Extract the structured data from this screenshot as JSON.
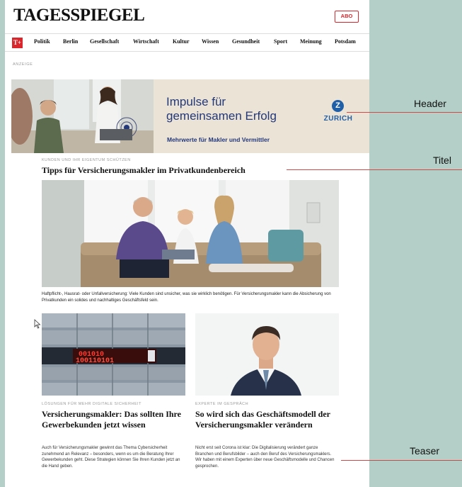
{
  "site": {
    "logo": "TAGESSPIEGEL",
    "abo_button": "ABO",
    "t_logo": "T+"
  },
  "nav": {
    "items": [
      "Politik",
      "Berlin",
      "Gesellschaft",
      "Wirtschaft",
      "Kultur",
      "Wissen",
      "Gesundheit",
      "Sport",
      "Meinung",
      "Potsdam"
    ]
  },
  "ad": {
    "label": "ANZEIGE",
    "headline_line1": "Impulse für",
    "headline_line2": "gemeinsamen Erfolg",
    "tagline": "Mehrwerte für Makler und Vermittler",
    "brand_mark": "Z",
    "brand": "ZURICH"
  },
  "main_article": {
    "kicker": "KUNDEN UND IHR EIGENTUM SCHÜTZEN",
    "title": "Tipps für Versicherungsmakler im Privatkundenbereich",
    "description": "Haftpflicht-, Hausrat- oder Unfallversicherung: Viele Kunden sind unsicher, was sie wirklich benötigen. Für Versicherungsmakler kann die Absicherung von Privatkunden ein solides und nachhaltiges Geschäftsfeld sein."
  },
  "teasers": [
    {
      "kicker": "LÖSUNGEN FÜR MEHR DIGITALE SICHERHEIT",
      "title": "Versicherungsmakler: Das sollten Ihre Gewerbekunden jetzt wissen",
      "text": "Auch für Versicherungsmakler gewinnt das Thema Cybersicherheit zunehmend an Relevanz – besonders, wenn es um die Beratung Ihrer Gewerbekunden geht. Diese Strategien können Sie Ihren Kunden jetzt an die Hand geben.",
      "image_code_line1": "001010",
      "image_code_line2": "100110101"
    },
    {
      "kicker": "EXPERTE IM GESPRÄCH",
      "title": "So wird sich das Geschäftsmodell der Versicherungsmakler verändern",
      "text": "Nicht erst seit Corona ist klar: Die Digitalisierung verändert ganze Branchen und Berufsbilder – auch den Beruf des Versicherungsmaklers. Wir haben mit einem Experten über neue Geschäftsmodelle und Chancen gesprochen."
    }
  ],
  "annotations": {
    "header": "Header",
    "titel": "Titel",
    "teaser": "Teaser"
  },
  "colors": {
    "brand_red": "#d8262c",
    "zurich_blue": "#1f5fa8",
    "ad_navy": "#24397a",
    "backdrop": "#b3cfc7",
    "annotation_line": "#d04a4a"
  }
}
